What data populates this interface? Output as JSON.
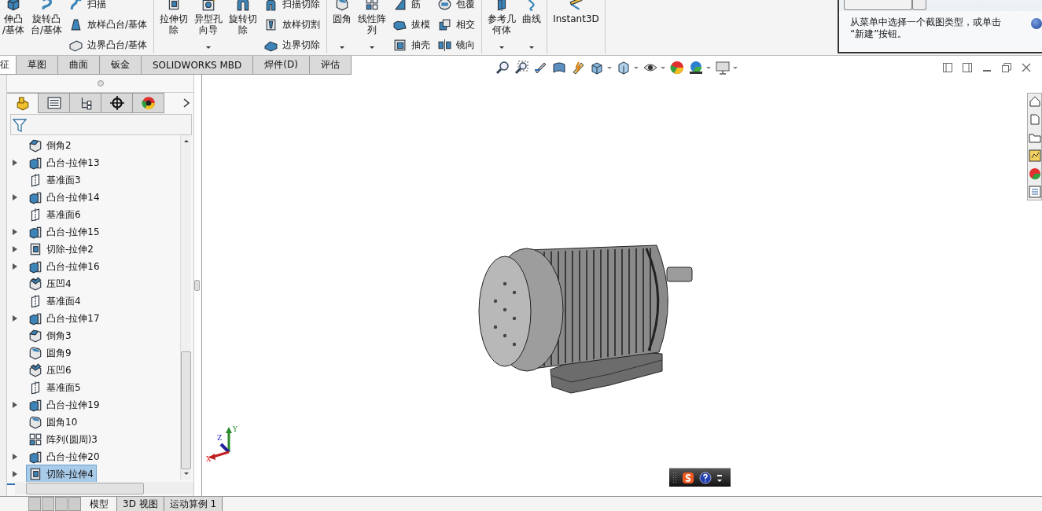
{
  "ribbon": {
    "groups": [
      {
        "large": [
          {
            "kind": "cube",
            "lines": [
              "伸凸",
              "/基体"
            ],
            "dropdown": false
          },
          {
            "kind": "revolve",
            "lines": [
              "旋转凸",
              "台/基体"
            ],
            "dropdown": false
          }
        ],
        "columns": [
          [
            {
              "kind": "sweep",
              "label": "扫描"
            },
            {
              "kind": "loft",
              "label": "放样凸台/基体"
            },
            {
              "kind": "boundary",
              "label": "边界凸台/基体"
            }
          ]
        ]
      },
      {
        "large": [
          {
            "kind": "cut",
            "lines": [
              "拉伸切",
              "除"
            ],
            "dropdown": false
          },
          {
            "kind": "hole",
            "lines": [
              "异型孔",
              "向导"
            ],
            "dropdown": true
          },
          {
            "kind": "revcut",
            "lines": [
              "旋转切",
              "除"
            ],
            "dropdown": false
          }
        ],
        "columns": [
          [
            {
              "kind": "sweepcut",
              "label": "扫描切除"
            },
            {
              "kind": "loftcut",
              "label": "放样切割"
            },
            {
              "kind": "boundarycut",
              "label": "边界切除"
            }
          ]
        ]
      },
      {
        "large": [
          {
            "kind": "fillet",
            "lines": [
              "圆角"
            ],
            "dropdown": true
          },
          {
            "kind": "pattern",
            "lines": [
              "线性阵",
              "列"
            ],
            "dropdown": true
          }
        ],
        "columns": [
          [
            {
              "kind": "rib",
              "label": "筋"
            },
            {
              "kind": "draft",
              "label": "拔模"
            },
            {
              "kind": "shell",
              "label": "抽壳"
            }
          ],
          [
            {
              "kind": "wrap",
              "label": "包覆"
            },
            {
              "kind": "intersect",
              "label": "相交"
            },
            {
              "kind": "mirror",
              "label": "镜向"
            }
          ]
        ]
      },
      {
        "large": [
          {
            "kind": "refgeom",
            "lines": [
              "参考几",
              "何体"
            ],
            "dropdown": true
          },
          {
            "kind": "curve",
            "lines": [
              "曲线"
            ],
            "dropdown": true
          }
        ]
      },
      {
        "large": [
          {
            "kind": "ruler",
            "lines": [
              "Instant3D"
            ],
            "dropdown": false
          }
        ]
      }
    ]
  },
  "snip_panel": {
    "lines": [
      "从菜单中选择一个截图类型，或单击",
      "“新建”按钮。"
    ]
  },
  "tabs": [
    {
      "label": "征",
      "selected": true
    },
    {
      "label": "草图",
      "selected": false
    },
    {
      "label": "曲面",
      "selected": false
    },
    {
      "label": "钣金",
      "selected": false
    },
    {
      "label": "SOLIDWORKS MBD",
      "selected": false
    },
    {
      "label": "焊件(D)",
      "selected": false
    },
    {
      "label": "评估",
      "selected": false
    }
  ],
  "panel_tabs": [
    {
      "kind": "feature",
      "selected": true
    },
    {
      "kind": "property",
      "selected": false
    },
    {
      "kind": "config",
      "selected": false
    },
    {
      "kind": "target",
      "selected": false
    },
    {
      "kind": "appearance",
      "selected": false
    }
  ],
  "tree": [
    {
      "kind": "chamfer",
      "label": "倒角2",
      "expandable": false,
      "selected": false
    },
    {
      "kind": "extrude",
      "label": "凸台-拉伸13",
      "expandable": true,
      "selected": false
    },
    {
      "kind": "plane",
      "label": "基准面3",
      "expandable": false,
      "selected": false
    },
    {
      "kind": "extrude",
      "label": "凸台-拉伸14",
      "expandable": true,
      "selected": false
    },
    {
      "kind": "plane",
      "label": "基准面6",
      "expandable": false,
      "selected": false
    },
    {
      "kind": "extrude",
      "label": "凸台-拉伸15",
      "expandable": true,
      "selected": false
    },
    {
      "kind": "cut",
      "label": "切除-拉伸2",
      "expandable": true,
      "selected": false
    },
    {
      "kind": "extrude",
      "label": "凸台-拉伸16",
      "expandable": true,
      "selected": false
    },
    {
      "kind": "dent",
      "label": "压凹4",
      "expandable": false,
      "selected": false
    },
    {
      "kind": "plane",
      "label": "基准面4",
      "expandable": false,
      "selected": false
    },
    {
      "kind": "extrude",
      "label": "凸台-拉伸17",
      "expandable": true,
      "selected": false
    },
    {
      "kind": "chamfer",
      "label": "倒角3",
      "expandable": false,
      "selected": false
    },
    {
      "kind": "fillet",
      "label": "圆角9",
      "expandable": false,
      "selected": false
    },
    {
      "kind": "dent",
      "label": "压凹6",
      "expandable": false,
      "selected": false
    },
    {
      "kind": "plane",
      "label": "基准面5",
      "expandable": false,
      "selected": false
    },
    {
      "kind": "extrude",
      "label": "凸台-拉伸19",
      "expandable": true,
      "selected": false
    },
    {
      "kind": "fillet",
      "label": "圆角10",
      "expandable": false,
      "selected": false
    },
    {
      "kind": "pattern",
      "label": "阵列(圆周)3",
      "expandable": false,
      "selected": false
    },
    {
      "kind": "extrude",
      "label": "凸台-拉伸20",
      "expandable": true,
      "selected": false
    },
    {
      "kind": "cut",
      "label": "切除-拉伸4",
      "expandable": true,
      "selected": true
    }
  ],
  "bottom_tabs": [
    {
      "label": "模型",
      "selected": true
    },
    {
      "label": "3D 视图",
      "selected": false
    },
    {
      "label": "运动算例 1",
      "selected": false
    }
  ],
  "triad": {
    "x": "X",
    "y": "Y",
    "z": "Z"
  }
}
